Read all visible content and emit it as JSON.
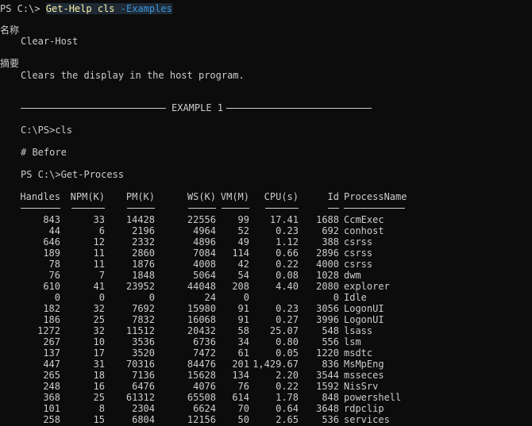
{
  "prompt": {
    "ps": "PS C:\\> ",
    "cmd1": "Get-Help",
    "cmd2": "cls",
    "param": "-Examples"
  },
  "name_heading": "名称",
  "name_value": "Clear-Host",
  "synopsis_heading": "摘要",
  "synopsis_value": "Clears the display in the host program.",
  "example_title": "EXAMPLE 1",
  "ex_line1": "C:\\PS>cls",
  "ex_line2": "# Before",
  "ex_line3": "PS C:\\>Get-Process",
  "table": {
    "headers": [
      "Handles",
      "NPM(K)",
      "PM(K)",
      "WS(K)",
      "VM(M)",
      "CPU(s)",
      "Id",
      "ProcessName"
    ],
    "rows": [
      [
        "843",
        "33",
        "14428",
        "22556",
        "99",
        "17.41",
        "1688",
        "CcmExec"
      ],
      [
        "44",
        "6",
        "2196",
        "4964",
        "52",
        "0.23",
        "692",
        "conhost"
      ],
      [
        "646",
        "12",
        "2332",
        "4896",
        "49",
        "1.12",
        "388",
        "csrss"
      ],
      [
        "189",
        "11",
        "2860",
        "7084",
        "114",
        "0.66",
        "2896",
        "csrss"
      ],
      [
        "78",
        "11",
        "1876",
        "4008",
        "42",
        "0.22",
        "4000",
        "csrss"
      ],
      [
        "76",
        "7",
        "1848",
        "5064",
        "54",
        "0.08",
        "1028",
        "dwm"
      ],
      [
        "610",
        "41",
        "23952",
        "44048",
        "208",
        "4.40",
        "2080",
        "explorer"
      ],
      [
        "0",
        "0",
        "0",
        "24",
        "0",
        "",
        "0",
        "Idle"
      ],
      [
        "182",
        "32",
        "7692",
        "15980",
        "91",
        "0.23",
        "3056",
        "LogonUI"
      ],
      [
        "186",
        "25",
        "7832",
        "16068",
        "91",
        "0.27",
        "3996",
        "LogonUI"
      ],
      [
        "1272",
        "32",
        "11512",
        "20432",
        "58",
        "25.07",
        "548",
        "lsass"
      ],
      [
        "267",
        "10",
        "3536",
        "6736",
        "34",
        "0.80",
        "556",
        "lsm"
      ],
      [
        "137",
        "17",
        "3520",
        "7472",
        "61",
        "0.05",
        "1220",
        "msdtc"
      ],
      [
        "447",
        "31",
        "70316",
        "84476",
        "201",
        "1,429.67",
        "836",
        "MsMpEng"
      ],
      [
        "265",
        "18",
        "7136",
        "15628",
        "134",
        "2.20",
        "3544",
        "msseces"
      ],
      [
        "248",
        "16",
        "6476",
        "4076",
        "76",
        "0.22",
        "1592",
        "NisSrv"
      ],
      [
        "368",
        "25",
        "61312",
        "65508",
        "614",
        "1.78",
        "848",
        "powershell"
      ],
      [
        "101",
        "8",
        "2304",
        "6624",
        "70",
        "0.64",
        "3648",
        "rdpclip"
      ],
      [
        "258",
        "15",
        "6804",
        "12156",
        "50",
        "2.65",
        "536",
        "services"
      ]
    ]
  }
}
